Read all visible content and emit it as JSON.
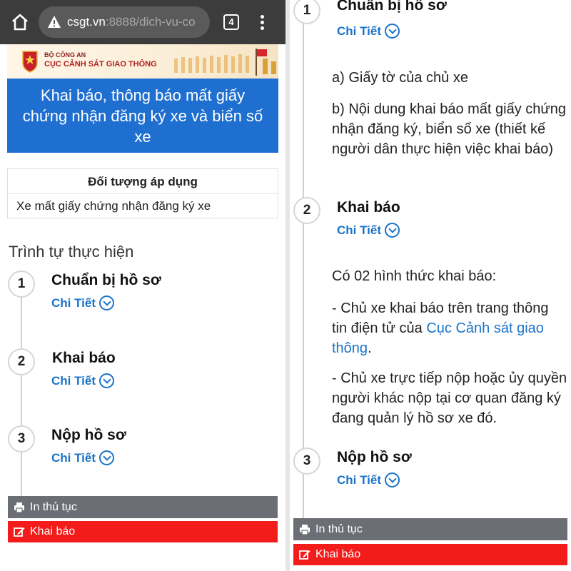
{
  "browser": {
    "url_host": "csgt.vn",
    "url_path": ":8888/dich-vu-co",
    "tab_count": "4"
  },
  "site": {
    "org_small": "BỘ CÔNG AN",
    "org_big": "CỤC CẢNH SÁT GIAO THÔNG"
  },
  "page_title": "Khai báo, thông báo mất giấy chứng nhận đăng ký xe và biển số xe",
  "apply": {
    "heading": "Đối tượng áp dụng",
    "value": "Xe mất giấy chứng nhận đăng ký xe"
  },
  "procedure_title": "Trình tự thực hiện",
  "detail_label": "Chi Tiết",
  "steps": [
    {
      "number": "1",
      "title": "Chuẩn bị hồ sơ"
    },
    {
      "number": "2",
      "title": "Khai báo"
    },
    {
      "number": "3",
      "title": "Nộp hồ sơ"
    }
  ],
  "step1_details": {
    "item_a": "a) Giấy tờ của chủ xe",
    "item_b": "b) Nội dung khai báo mất giấy chứng nhận đăng ký, biển số xe (thiết kế người dân thực hiện việc khai báo)"
  },
  "step2_details": {
    "intro": "Có 02 hình thức khai báo:",
    "option1_prefix": "- Chủ xe khai báo trên trang thông tin điện tử của ",
    "option1_link": "Cục Cảnh sát giao thông",
    "option1_suffix": ".",
    "option2": "- Chủ xe trực tiếp nộp hoặc ủy quyền người khác nộp tại cơ quan đăng ký đang quản lý hồ sơ xe đó."
  },
  "actions": {
    "print_label": "In thủ tục",
    "declare_label": "Khai báo"
  },
  "colors": {
    "banner_blue": "#1f6fd0",
    "link_blue": "#1a73c8",
    "declare_red": "#f41b1b",
    "print_gray": "#6b6f75"
  }
}
